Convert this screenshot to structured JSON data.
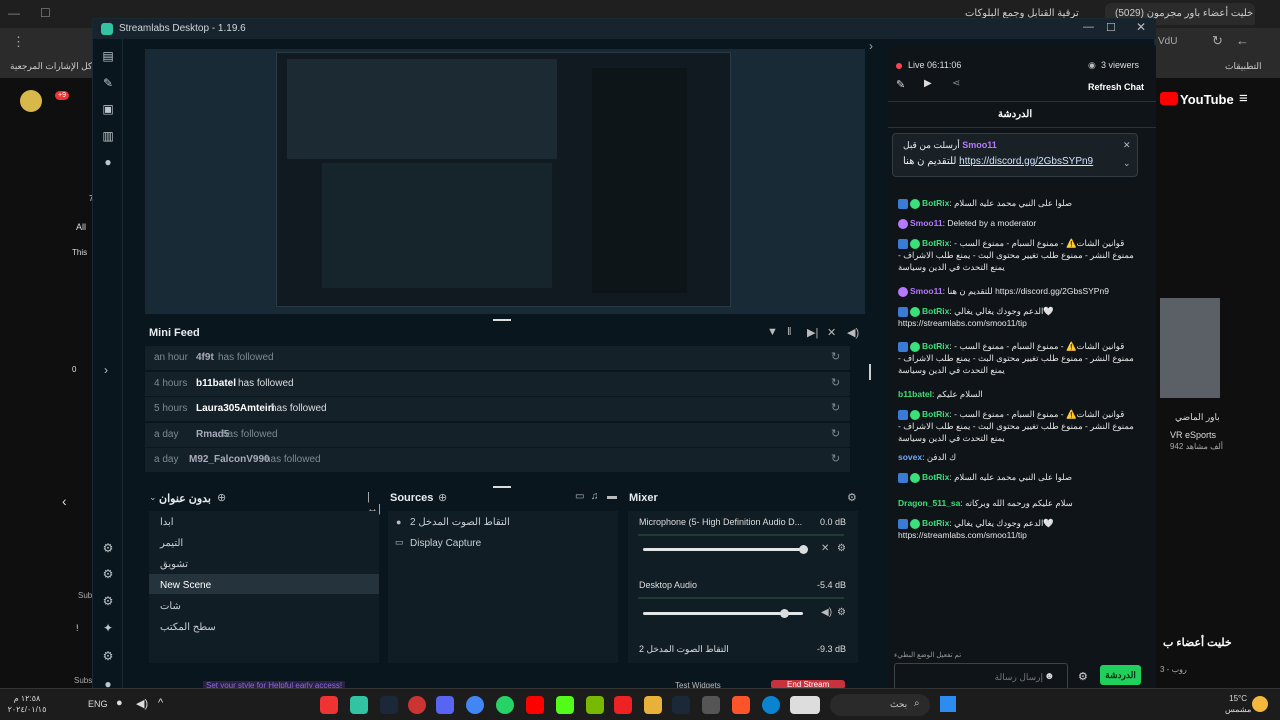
{
  "browser": {
    "tabs": [
      {
        "label": "(5029) خليت أعضاء باور مجرمون"
      },
      {
        "label": "ترقية القنابل وجمع البلوكات"
      }
    ],
    "url_fragment": "VdU",
    "bookmarks_label": "كل الإشارات المرجعية",
    "apps_label": "التطبيقات",
    "youtube_logo": "YouTube",
    "notif_count": "+9",
    "video_title": "خليت أعضاء ب",
    "channel_snippet": "باور الماضي",
    "channel_name": "VR eSports",
    "channel_meta": "942 ألف مشاهد",
    "left_all": "All",
    "left_this": "This",
    "left_zero": "0",
    "left_sub1": "Sub",
    "left_sub2": "Subs",
    "left_seven": "7",
    "left_exclaim": "!",
    "right_meta": "روب - 3"
  },
  "taskbar": {
    "time": "١٢:٥٨ م",
    "date": "٢٠٢٤/٠١/١٥",
    "lang": "ENG",
    "weather_temp": "15°C",
    "weather_desc": "مشمس",
    "search_label": "بحث"
  },
  "window": {
    "title": "Streamlabs Desktop - 1.19.6"
  },
  "mini_feed": {
    "title": "Mini Feed",
    "rows": [
      {
        "time": "an hour",
        "user": "4f9t",
        "action": "has followed"
      },
      {
        "time": "4 hours",
        "user": "b11batel",
        "action": "has followed"
      },
      {
        "time": "5 hours",
        "user": "Laura305Amteiri",
        "action": "has followed"
      },
      {
        "time": "a day",
        "user": "Rmad5",
        "action": "has followed"
      },
      {
        "time": "a day",
        "user": "M92_FalconV990",
        "action": "has followed"
      }
    ]
  },
  "scenes": {
    "title": "بدون عنوان",
    "items": [
      "ابدا",
      "التيمر",
      "تشويق",
      "New Scene",
      "شات",
      "سطح المكتب"
    ]
  },
  "sources": {
    "title": "Sources",
    "items": [
      "التقاط الصوت المدخل 2",
      "Display Capture"
    ]
  },
  "mixer": {
    "title": "Mixer",
    "channels": [
      {
        "name": "Microphone (5- High Definition Audio D...",
        "db": "0.0 dB",
        "level": 1.0
      },
      {
        "name": "Desktop Audio",
        "db": "-5.4 dB",
        "level": 0.88
      },
      {
        "name": "التقاط الصوت المدخل 2",
        "db": "-9.3 dB",
        "level": 0.75
      }
    ]
  },
  "bottom_bar": {
    "promo": "Set your style for Helpful early access!",
    "test_widgets": "Test Widgets",
    "end_stream": "End Stream"
  },
  "chat": {
    "live_label": "Live 06:11:06",
    "viewers": "3 viewers",
    "refresh": "Refresh Chat",
    "header": "الدردشة",
    "pinned_by": "أرسلت من قبل",
    "pinned_user": "Smoo11",
    "pinned_text": "للتقديم ن هنا",
    "pinned_link": "https://discord.gg/2GbsSYPn9",
    "messages": [
      {
        "user": "BotRix",
        "color": "green",
        "text": "صلوا على النبي محمد عليه السلام"
      },
      {
        "user": "Smoo11",
        "color": "purple",
        "text": "Deleted by a moderator"
      },
      {
        "user": "BotRix",
        "color": "green",
        "text": "قوانين الشات⚠️ - ممنوع السبام - ممنوع السب - ممنوع النشر - ممنوع طلب تغيير محتوى البث - يمنع طلب الاشراف - يمنع التحدث في الدين وسياسة"
      },
      {
        "user": "Smoo11",
        "color": "purple",
        "text": "للتقديم ن هنا https://discord.gg/2GbsSYPn9"
      },
      {
        "user": "BotRix",
        "color": "green",
        "text": "الدعم وجودك يغالي يغالي🤍 https://streamlabs.com/smoo11/tip"
      },
      {
        "user": "BotRix",
        "color": "green",
        "text": "قوانين الشات⚠️ - ممنوع السبام - ممنوع السب - ممنوع النشر - ممنوع طلب تغيير محتوى البث - يمنع طلب الاشراف - يمنع التحدث في الدين وسياسة"
      },
      {
        "user": "b11batel",
        "color": "green",
        "text": "السلام عليكم"
      },
      {
        "user": "BotRix",
        "color": "green",
        "text": "قوانين الشات⚠️ - ممنوع السبام - ممنوع السب - ممنوع النشر - ممنوع طلب تغيير محتوى البث - يمنع طلب الاشراف - يمنع التحدث في الدين وسياسة"
      },
      {
        "user": "sovex",
        "color": "blue",
        "text": "ك الدفن"
      },
      {
        "user": "BotRix",
        "color": "green",
        "text": "صلوا على النبي محمد عليه السلام"
      },
      {
        "user": "Dragon_511_sa",
        "color": "green",
        "text": "سلام عليكم ورحمه الله وبركاته"
      },
      {
        "user": "BotRix",
        "color": "green",
        "text": "الدعم وجودك يغالي يغالي🤍 https://streamlabs.com/smoo11/tip"
      }
    ],
    "slow_mode": "تم تفعيل الوضع البطيء",
    "input_placeholder": "إرسال رسالة",
    "send_label": "الدردشة"
  },
  "colors": {
    "accent": "#31c3a2",
    "send_green": "#1fd15c",
    "live_red": "#ff4655"
  }
}
